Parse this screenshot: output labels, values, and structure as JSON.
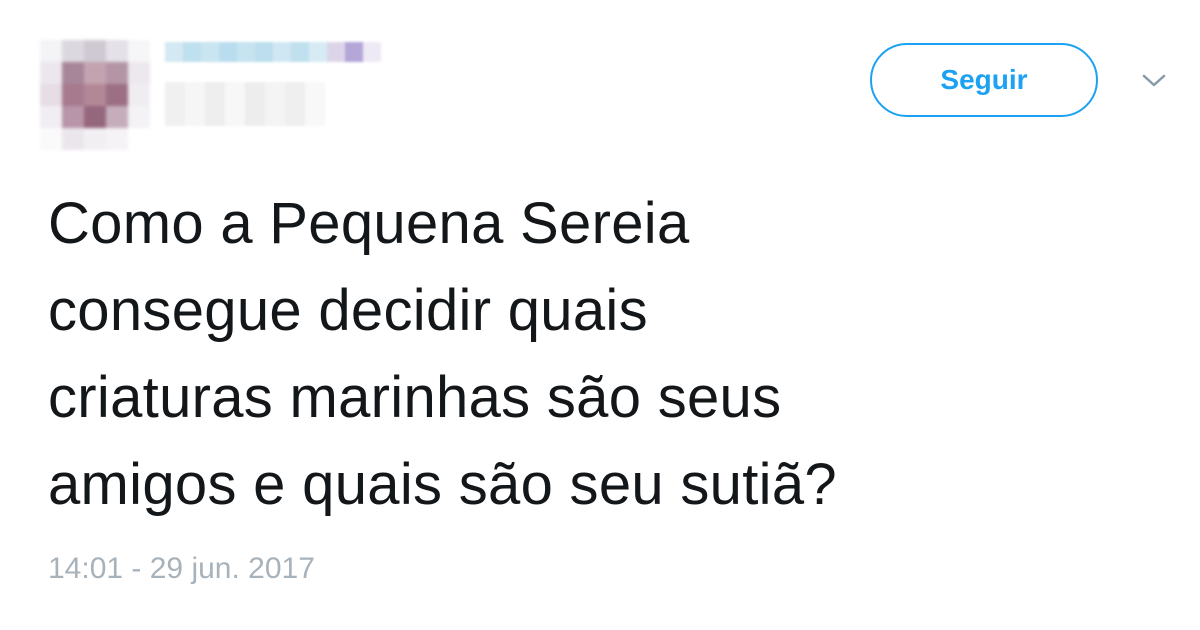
{
  "tweet": {
    "follow_label": "Seguir",
    "text": "Como a Pequena Sereia\nconsegue decidir quais\ncriaturas marinhas são seus\namigos e quais são seu sutiã?",
    "timestamp": "14:01 - 29 jun. 2017",
    "menu_icon": "chevron-down-icon"
  },
  "colors": {
    "accent": "#1da1f2",
    "text": "#14171a",
    "muted": "#a8b2bb",
    "background": "#ffffff"
  }
}
